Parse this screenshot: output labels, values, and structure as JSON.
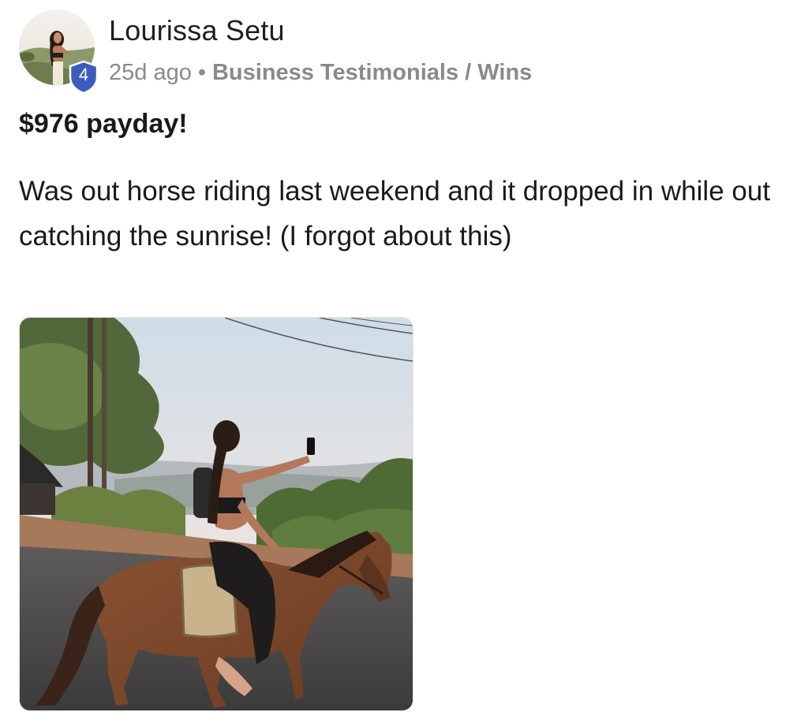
{
  "post": {
    "author": "Lourissa Setu",
    "level": "4",
    "time_ago": "25d ago",
    "separator": "•",
    "category": "Business Testimonials / Wins",
    "title": "$976 payday!",
    "body": "Was out horse riding last weekend and it dropped in while out catching the sunrise! (I forgot about this)"
  },
  "icons": {
    "avatar": "avatar-photo",
    "level_badge": "shield-icon",
    "attachment": "horse-riding-photo"
  },
  "colors": {
    "badge": "#3d5bbf",
    "meta_text": "#8a8a8a"
  }
}
